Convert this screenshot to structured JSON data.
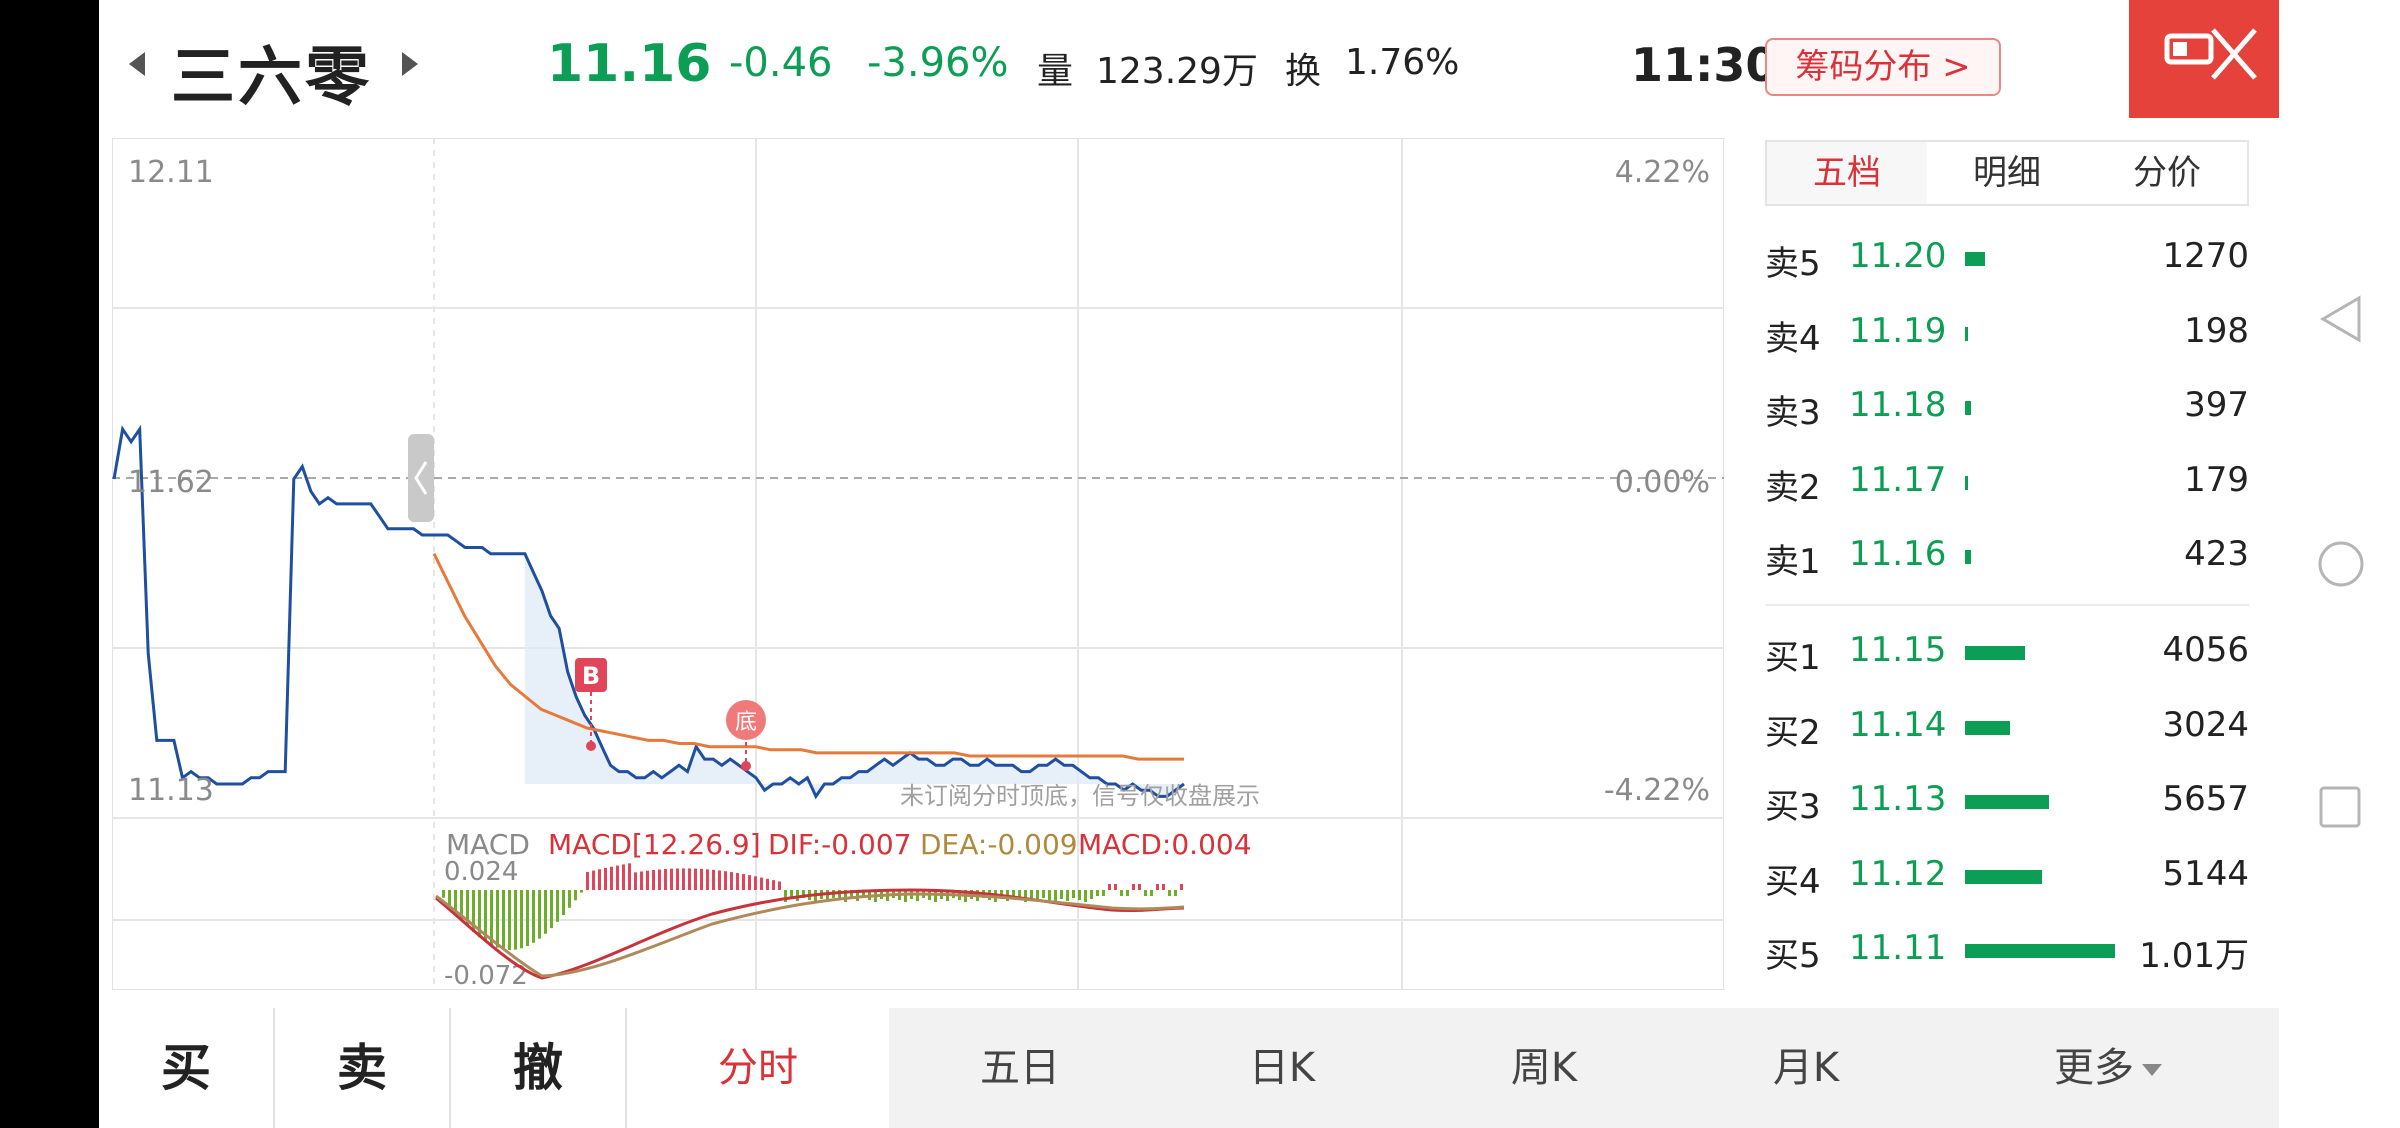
{
  "header": {
    "stock_name": "三六零",
    "price": "11.16",
    "change": "-0.46",
    "change_pct": "-3.96%",
    "volume_label": "量",
    "volume_value": "123.29万",
    "turnover_label": "换",
    "turnover_value": "1.76%",
    "time": "11:30",
    "chip_button": "筹码分布 >"
  },
  "chart": {
    "price_top": "12.11",
    "price_mid": "11.62",
    "price_bottom": "11.13",
    "pct_top": "4.22%",
    "pct_mid": "0.00%",
    "pct_bottom": "-4.22%",
    "signal_b": "B",
    "signal_di": "底",
    "watermark": "未订阅分时顶底，信号仅收盘展示",
    "macd_name": "MACD",
    "macd_params": "MACD[12.26.9]",
    "dif": "DIF:-0.007",
    "dea": "DEA:-0.009",
    "macd_val": "MACD:0.004",
    "macd_top": "0.024",
    "macd_bottom": "-0.072"
  },
  "chart_data": {
    "type": "line",
    "price_range": [
      11.13,
      12.11
    ],
    "prev_close": 11.62,
    "series": [
      {
        "values": [
          11.62,
          11.7,
          11.68,
          11.7,
          11.34,
          11.2,
          11.2,
          11.2,
          11.14,
          11.15,
          11.14,
          11.14,
          11.13,
          11.13,
          11.13,
          11.13,
          11.14,
          11.14,
          11.15,
          11.15,
          11.15,
          11.62,
          11.64,
          11.6,
          11.58,
          11.59,
          11.58,
          11.58,
          11.58,
          11.58,
          11.58,
          11.56,
          11.54,
          11.54,
          11.54,
          11.54,
          11.53,
          11.53,
          11.53,
          11.53,
          11.52,
          11.51,
          11.51,
          11.51,
          11.5,
          11.5,
          11.5,
          11.5,
          11.5,
          11.47,
          11.44,
          11.4,
          11.38,
          11.31,
          11.27,
          11.24,
          11.22,
          11.19,
          11.16,
          11.15,
          11.15,
          11.14,
          11.14,
          11.15,
          11.14,
          11.15,
          11.16,
          11.15,
          11.19,
          11.17,
          11.17,
          11.16,
          11.17,
          11.16,
          11.15,
          11.14,
          11.12,
          11.13,
          11.13,
          11.14,
          11.13,
          11.14,
          11.11,
          11.13,
          11.13,
          11.14,
          11.14,
          11.15,
          11.15,
          11.16,
          11.17,
          11.16,
          11.17,
          11.18,
          11.17,
          11.17,
          11.16,
          11.16,
          11.17,
          11.17,
          11.16,
          11.16,
          11.17,
          11.16,
          11.16,
          11.16,
          11.15,
          11.15,
          11.16,
          11.16,
          11.17,
          11.16,
          11.16,
          11.15,
          11.14,
          11.14,
          11.13,
          11.13,
          11.12,
          11.13,
          11.12,
          11.12,
          11.11,
          11.11,
          11.12,
          11.13
        ]
      },
      {
        "values": [
          11.5,
          11.45,
          11.4,
          11.36,
          11.32,
          11.29,
          11.27,
          11.25,
          11.24,
          11.23,
          11.22,
          11.215,
          11.21,
          11.205,
          11.2,
          11.2,
          11.195,
          11.195,
          11.19,
          11.19,
          11.19,
          11.19,
          11.185,
          11.185,
          11.185,
          11.18,
          11.18,
          11.18,
          11.18,
          11.18,
          11.18,
          11.18,
          11.18,
          11.18,
          11.18,
          11.175,
          11.175,
          11.175,
          11.175,
          11.175,
          11.175,
          11.175,
          11.175,
          11.175,
          11.175,
          11.175,
          11.17,
          11.17,
          11.17,
          11.17
        ]
      }
    ]
  },
  "order_book": {
    "tabs": [
      "五档",
      "明细",
      "分价"
    ],
    "sell": [
      {
        "label": "卖5",
        "price": "11.20",
        "vol": "1270",
        "bar": 0.13
      },
      {
        "label": "卖4",
        "price": "11.19",
        "vol": "198",
        "bar": 0.02
      },
      {
        "label": "卖3",
        "price": "11.18",
        "vol": "397",
        "bar": 0.04
      },
      {
        "label": "卖2",
        "price": "11.17",
        "vol": "179",
        "bar": 0.02
      },
      {
        "label": "卖1",
        "price": "11.16",
        "vol": "423",
        "bar": 0.04
      }
    ],
    "buy": [
      {
        "label": "买1",
        "price": "11.15",
        "vol": "4056",
        "bar": 0.4
      },
      {
        "label": "买2",
        "price": "11.14",
        "vol": "3024",
        "bar": 0.3
      },
      {
        "label": "买3",
        "price": "11.13",
        "vol": "5657",
        "bar": 0.56
      },
      {
        "label": "买4",
        "price": "11.12",
        "vol": "5144",
        "bar": 0.51
      },
      {
        "label": "买5",
        "price": "11.11",
        "vol": "1.01万",
        "bar": 1.0
      }
    ]
  },
  "bottom_bar": {
    "buy": "买",
    "sell": "卖",
    "cancel": "撤",
    "periods": [
      "分时",
      "五日",
      "日K",
      "周K",
      "月K",
      "更多"
    ]
  },
  "colors": {
    "up_red": "#d8323a",
    "down_green": "#0d9e55",
    "price_line": "#1f4fa0",
    "avg_line": "#e57a3c"
  }
}
